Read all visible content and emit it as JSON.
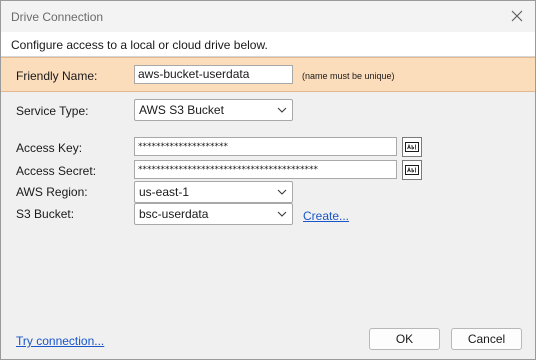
{
  "window": {
    "title": "Drive Connection"
  },
  "header": {
    "text": "Configure access to a local or cloud drive below."
  },
  "form": {
    "friendly_name": {
      "label": "Friendly Name:",
      "value": "aws-bucket-userdata",
      "hint": "(name must be unique)"
    },
    "service_type": {
      "label": "Service Type:",
      "value": "AWS S3 Bucket"
    },
    "access_key": {
      "label": "Access Key:",
      "value": "********************"
    },
    "access_secret": {
      "label": "Access Secret:",
      "value": "****************************************"
    },
    "aws_region": {
      "label": "AWS Region:",
      "value": "us-east-1"
    },
    "s3_bucket": {
      "label": "S3 Bucket:",
      "value": "bsc-userdata",
      "create_link": "Create..."
    }
  },
  "footer": {
    "try_link": "Try connection...",
    "ok_label": "OK",
    "cancel_label": "Cancel"
  },
  "icons": {
    "close": "close-icon",
    "reveal": "reveal-text-icon",
    "dropdown": "chevron-down-icon"
  },
  "colors": {
    "highlight_band": "#fbdcbb",
    "link": "#1a56c9"
  }
}
